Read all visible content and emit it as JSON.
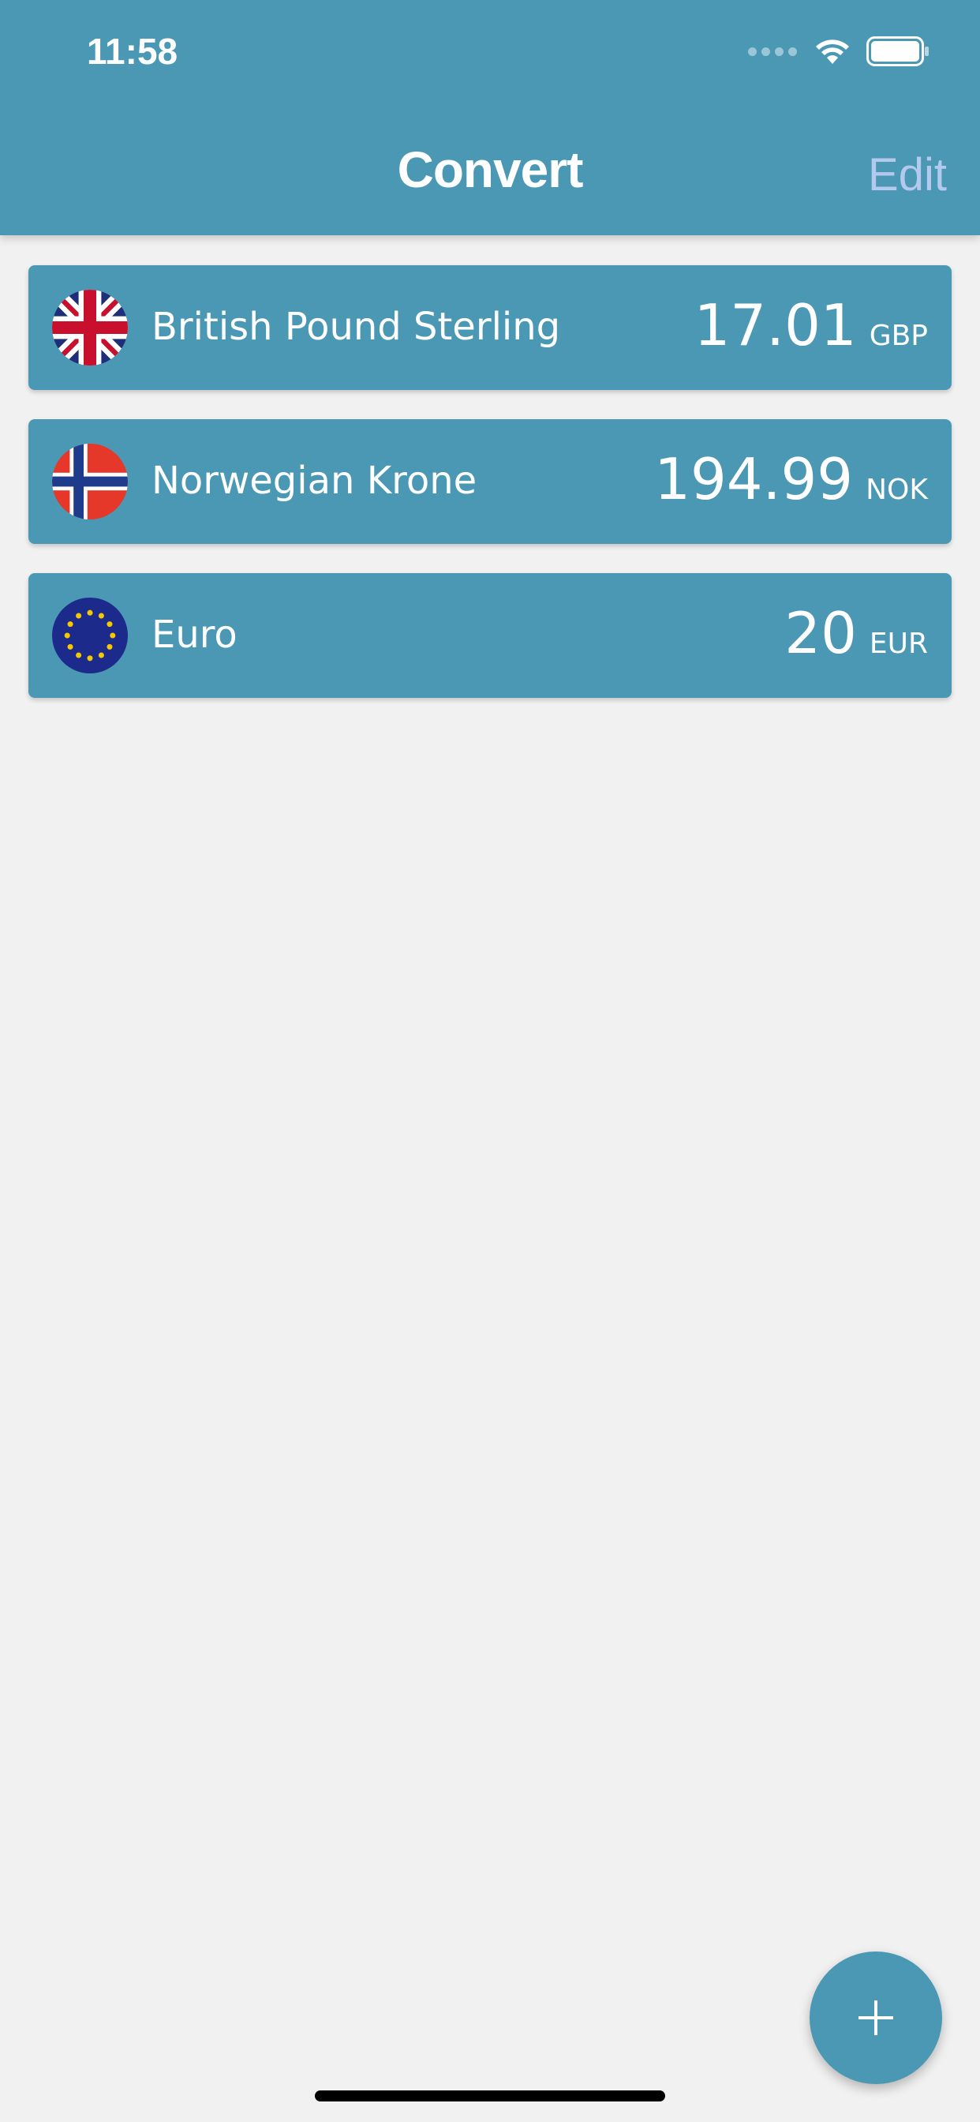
{
  "status_bar": {
    "time": "11:58"
  },
  "nav": {
    "title": "Convert",
    "edit_label": "Edit"
  },
  "currencies": [
    {
      "name": "British Pound Sterling",
      "amount": "17.01",
      "code": "GBP",
      "flag_icon": "uk-flag-icon"
    },
    {
      "name": "Norwegian Krone",
      "amount": "194.99",
      "code": "NOK",
      "flag_icon": "norway-flag-icon"
    },
    {
      "name": "Euro",
      "amount": "20",
      "code": "EUR",
      "flag_icon": "eu-flag-icon"
    }
  ],
  "fab": {
    "icon": "plus-icon"
  },
  "colors": {
    "primary": "#4a98b4",
    "background": "#f1f1f1",
    "edit_text": "#b4c9ee"
  }
}
